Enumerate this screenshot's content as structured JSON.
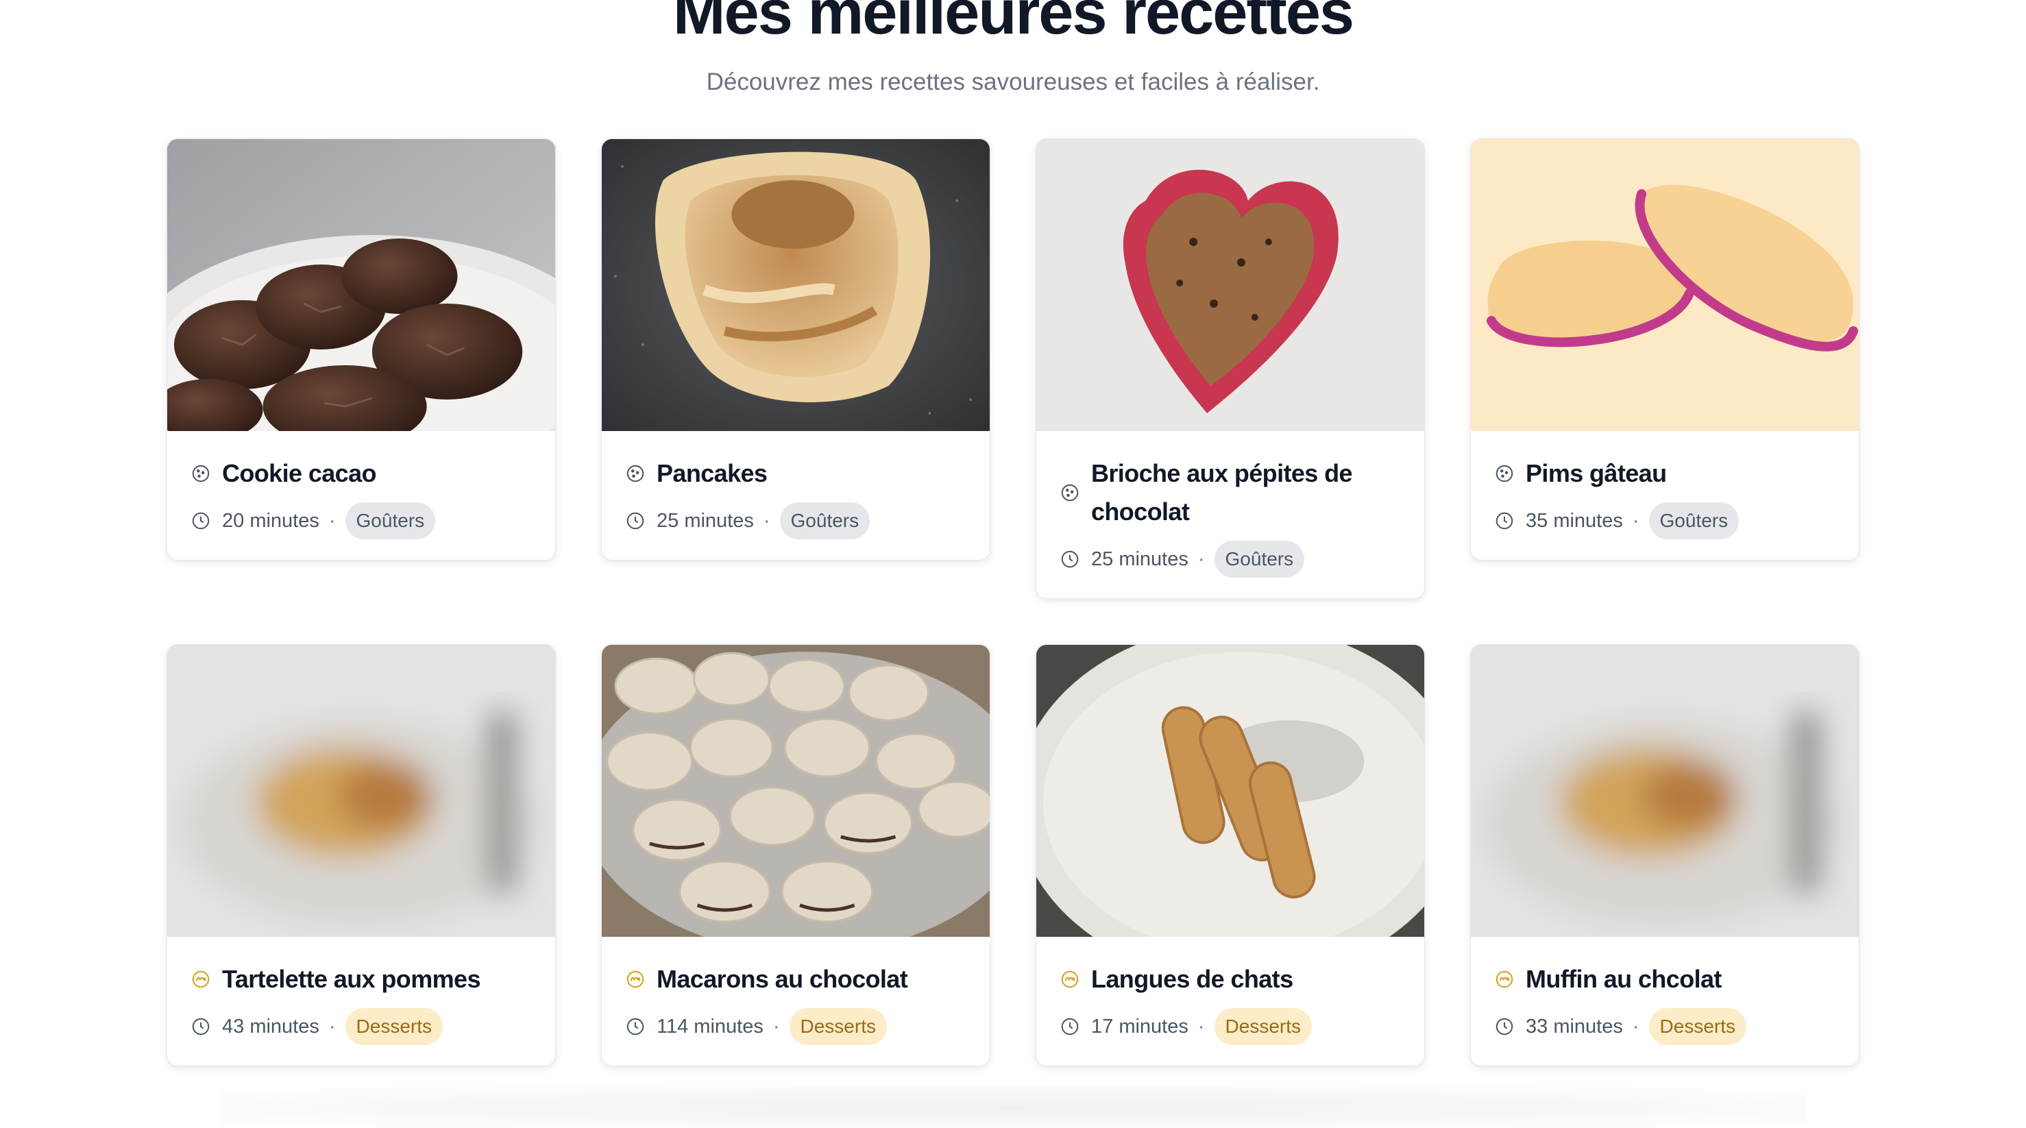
{
  "header": {
    "title": "Mes meilleures recettes",
    "subtitle": "Découvrez mes recettes savoureuses et faciles à réaliser."
  },
  "colors": {
    "gouters_badge_bg": "#e5e7eb",
    "desserts_badge_bg": "#fdecc8",
    "desserts_icon": "#d4a017"
  },
  "recipes": [
    {
      "title": "Cookie cacao",
      "duration": "20 minutes",
      "separator": "·",
      "category": "Goûters",
      "icon": "cookie-icon",
      "image": "chocolate-cookies-photo"
    },
    {
      "title": "Pancakes",
      "duration": "25 minutes",
      "separator": "·",
      "category": "Goûters",
      "icon": "cookie-icon",
      "image": "pancake-photo"
    },
    {
      "title": "Brioche aux pépites de chocolat",
      "duration": "25 minutes",
      "separator": "·",
      "category": "Goûters",
      "icon": "cookie-icon",
      "image": "brioche-heart-mold-photo"
    },
    {
      "title": "Pims gâteau",
      "duration": "35 minutes",
      "separator": "·",
      "category": "Goûters",
      "icon": "cookie-icon",
      "image": "pims-illustration"
    },
    {
      "title": "Tartelette aux pommes",
      "duration": "43 minutes",
      "separator": "·",
      "category": "Desserts",
      "icon": "dessert-icon",
      "image": "blurred-placeholder-photo"
    },
    {
      "title": "Macarons au chocolat",
      "duration": "114 minutes",
      "separator": "·",
      "category": "Desserts",
      "icon": "dessert-icon",
      "image": "macarons-photo"
    },
    {
      "title": "Langues de chats",
      "duration": "17 minutes",
      "separator": "·",
      "category": "Desserts",
      "icon": "dessert-icon",
      "image": "langues-de-chat-photo"
    },
    {
      "title": "Muffin au chcolat",
      "duration": "33 minutes",
      "separator": "·",
      "category": "Desserts",
      "icon": "dessert-icon",
      "image": "blurred-placeholder-photo"
    }
  ]
}
